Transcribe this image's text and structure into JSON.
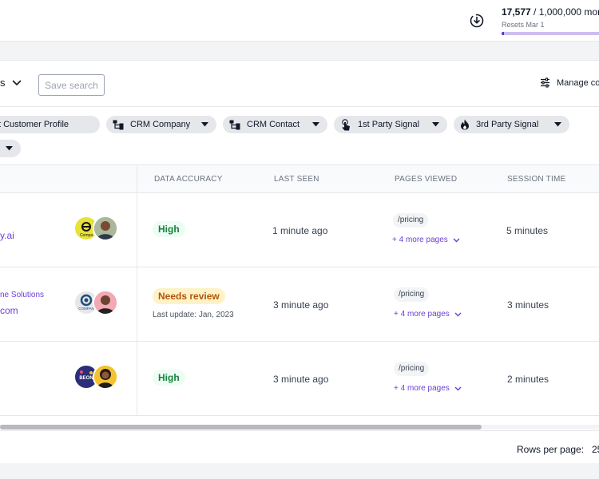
{
  "usage": {
    "used": "17,577",
    "limit": " / 1,000,000 mor",
    "resets": "Resets Mar 1",
    "progress_fraction": 0.018,
    "accent": "#5b34c9"
  },
  "toolbar": {
    "view_label": "s",
    "save_search_label": "Save search",
    "manage_label": "Manage co"
  },
  "filters": [
    {
      "label": "t Customer Profile",
      "icon": "none"
    },
    {
      "label": "CRM Company",
      "icon": "hierarchy-icon"
    },
    {
      "label": "CRM Contact",
      "icon": "hierarchy-icon"
    },
    {
      "label": "1st Party Signal",
      "icon": "tap-icon"
    },
    {
      "label": "3rd Party Signal",
      "icon": "fire-icon"
    },
    {
      "label": "",
      "icon": "none"
    }
  ],
  "table": {
    "headers": [
      "DATA ACCURACY",
      "LAST SEEN",
      "PAGES VIEWED",
      "SESSION TIME"
    ],
    "rows": [
      {
        "company_name": "",
        "domain": "y.ai",
        "accuracy": "High",
        "accuracy_level": "high",
        "last_update": "",
        "last_seen": "1 minute ago",
        "page": "/pricing",
        "more_pages": "+ 4 more pages",
        "session_time": "5 minutes",
        "logo_label": "Compa"
      },
      {
        "company_name": "ne Solutions",
        "domain": "com",
        "accuracy": "Needs review",
        "accuracy_level": "review",
        "last_update": "Last update: Jan, 2023",
        "last_seen": "3 minute ago",
        "page": "/pricing",
        "more_pages": "+ 4 more pages",
        "session_time": "3 minutes",
        "logo_label": "COMPAN"
      },
      {
        "company_name": "",
        "domain": "",
        "accuracy": "High",
        "accuracy_level": "high",
        "last_update": "",
        "last_seen": "3 minute ago",
        "page": "/pricing",
        "more_pages": "+ 4 more pages",
        "session_time": "2 minutes",
        "logo_label": "BEON"
      }
    ]
  },
  "footer": {
    "rows_per_page_label": "Rows per page:",
    "rows_per_page_value": "25"
  }
}
